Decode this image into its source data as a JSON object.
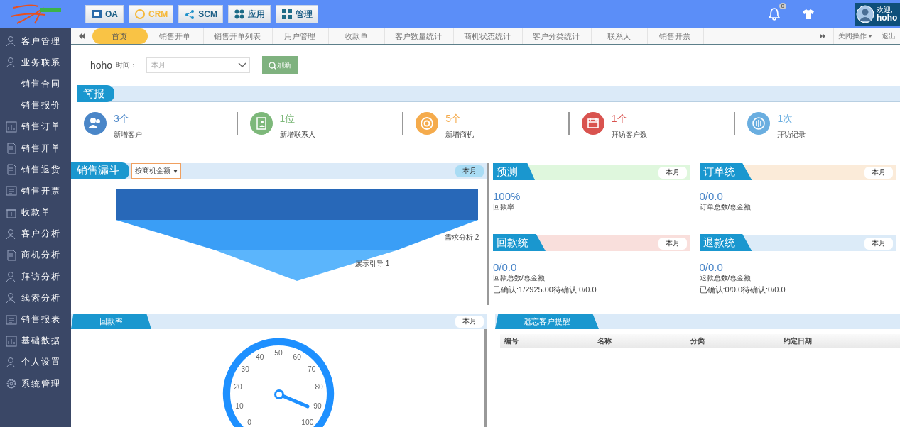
{
  "header": {
    "modules": [
      {
        "label": "OA",
        "selected": false,
        "kind": "oa"
      },
      {
        "label": "CRM",
        "selected": true,
        "kind": "crm"
      },
      {
        "label": "SCM",
        "selected": false,
        "kind": "scm"
      },
      {
        "label": "应用",
        "selected": false,
        "kind": "apps"
      },
      {
        "label": "管理",
        "selected": false,
        "kind": "manage"
      }
    ],
    "notification_count": "0",
    "welcome": "欢迎,",
    "user": "hoho"
  },
  "sidebar": {
    "items": [
      {
        "label": "客户管理",
        "kind": "group"
      },
      {
        "label": "业务联系",
        "kind": "group"
      },
      {
        "label": "销售合同",
        "kind": "sub"
      },
      {
        "label": "销售报价",
        "kind": "sub"
      },
      {
        "label": "销售订单",
        "kind": "group"
      },
      {
        "label": "销售开单",
        "kind": "group"
      },
      {
        "label": "销售退货",
        "kind": "group"
      },
      {
        "label": "销售开票",
        "kind": "group"
      },
      {
        "label": "收款单",
        "kind": "group"
      },
      {
        "label": "客户分析",
        "kind": "group"
      },
      {
        "label": "商机分析",
        "kind": "group"
      },
      {
        "label": "拜访分析",
        "kind": "group"
      },
      {
        "label": "线索分析",
        "kind": "group"
      },
      {
        "label": "销售报表",
        "kind": "group"
      },
      {
        "label": "基础数据",
        "kind": "group"
      },
      {
        "label": "个人设置",
        "kind": "group"
      },
      {
        "label": "系统管理",
        "kind": "group"
      }
    ]
  },
  "tabs": {
    "items": [
      {
        "label": "首页",
        "selected": true
      },
      {
        "label": "销售开单",
        "selected": false
      },
      {
        "label": "销售开单列表",
        "selected": false
      },
      {
        "label": "用户管理",
        "selected": false
      },
      {
        "label": "收款单",
        "selected": false
      },
      {
        "label": "客户数量统计",
        "selected": false
      },
      {
        "label": "商机状态统计",
        "selected": false
      },
      {
        "label": "客户分类统计",
        "selected": false
      },
      {
        "label": "联系人",
        "selected": false
      },
      {
        "label": "销售开票",
        "selected": false
      }
    ],
    "close_menu": "关闭操作",
    "logout": "退出"
  },
  "filter": {
    "user": "hoho",
    "time_label": "时间：",
    "period": "本月",
    "refresh": "刷新"
  },
  "summary": {
    "title": "简报",
    "stats": [
      {
        "value": "3个",
        "label": "新增客户",
        "color": "#4a86c8"
      },
      {
        "value": "1位",
        "label": "新增联系人",
        "color": "#7db87a"
      },
      {
        "value": "5个",
        "label": "新增商机",
        "color": "#f5ab4c"
      },
      {
        "value": "1个",
        "label": "拜访客户数",
        "color": "#d9534f"
      },
      {
        "value": "1次",
        "label": "拜访记录",
        "color": "#6aaee0"
      }
    ]
  },
  "funnel": {
    "title": "销售漏斗",
    "mode": "按商机金额",
    "period": "本月",
    "labels": [
      "需求分析 2",
      "展示引导 1"
    ]
  },
  "cards": [
    {
      "title": "预测",
      "period": "本月",
      "value": "100%",
      "caption": "回款率",
      "color": "#dff7dd"
    },
    {
      "title": "订单统",
      "period": "本月",
      "value": "0/0.0",
      "caption": "订单总数/总金额",
      "color": "#fbebd9"
    },
    {
      "title": "回款统",
      "period": "本月",
      "value": "0/0.0",
      "caption": "回款总数/总金额",
      "note": "已确认:1/2925.00待确认:0/0.0",
      "color": "#f9dfdc"
    },
    {
      "title": "退款统",
      "period": "本月",
      "value": "0/0.0",
      "caption": "退款总数/总金额",
      "note": "已确认:0/0.0待确认:0/0.0",
      "color": "#dcebf8"
    }
  ],
  "gauge": {
    "title": "回款率",
    "period": "本月",
    "ticks": [
      "0",
      "10",
      "20",
      "30",
      "40",
      "50",
      "60",
      "70",
      "80",
      "90",
      "100"
    ]
  },
  "reminder": {
    "title": "遗忘客户提醒",
    "columns": [
      "编号",
      "名称",
      "分类",
      "约定日期"
    ]
  }
}
